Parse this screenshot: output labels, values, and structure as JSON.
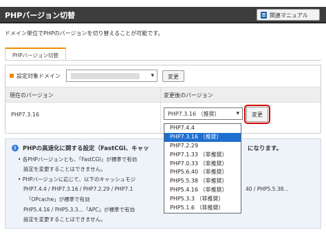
{
  "header": {
    "title": "PHPバージョン切替",
    "manual_label": "関連マニュアル"
  },
  "description": "ドメイン単位でPHPのバージョンを切り替えることが可能です。",
  "tab_label": "PHPバージョン切替",
  "filter": {
    "label": "設定対象ドメイン",
    "domain_value": "",
    "button_label": "変更"
  },
  "table": {
    "headers": [
      "現在のバージョン",
      "変更後のバージョン"
    ],
    "current_version": "PHP7.3.16",
    "selected_version": "PHP7.3.16 （推奨）",
    "change_label": "変更"
  },
  "dropdown": {
    "options": [
      "PHP7.4.4",
      "PHP7.3.16 （推奨）",
      "PHP7.2.29",
      "PHP7.1.33 （非推奨）",
      "PHP7.0.33 （非推奨）",
      "PHP5.6.40 （非推奨）",
      "PHP5.5.38 （非推奨）",
      "PHP5.4.16 （非推奨）",
      "PHP5.3.3 （非推奨）",
      "PHP5.1.6 （非推奨）"
    ],
    "selected_index": 1
  },
  "info": {
    "title": "PHPの高速化に関する設定（FastCGI、キャッ",
    "title_end": "になります。",
    "lines": [
      "• 各PHPバージョンとも、「FastCGI」が標準で有効",
      "設定を変更することはできません。",
      "• PHPバージョンに応じて、以下のキャッシュモジ",
      "PHP7.4.4 / PHP7.3.16 / PHP7.2.29 / PHP7.1",
      "「OPcache」が標準で有効",
      "PHP5.4.16 / PHP5.3.3…「APC」が標準で有効",
      "設定を変更することはできません。"
    ],
    "line_fragment": "40 / PHP5.5.38…"
  }
}
